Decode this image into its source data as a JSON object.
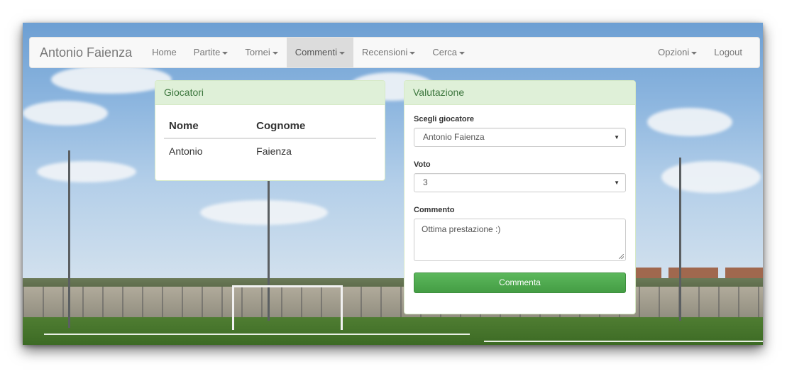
{
  "navbar": {
    "brand": "Antonio Faienza",
    "items": [
      {
        "label": "Home",
        "dropdown": false,
        "active": false
      },
      {
        "label": "Partite",
        "dropdown": true,
        "active": false
      },
      {
        "label": "Tornei",
        "dropdown": true,
        "active": false
      },
      {
        "label": "Commenti",
        "dropdown": true,
        "active": true
      },
      {
        "label": "Recensioni",
        "dropdown": true,
        "active": false
      },
      {
        "label": "Cerca",
        "dropdown": true,
        "active": false
      }
    ],
    "right_items": [
      {
        "label": "Opzioni",
        "dropdown": true
      },
      {
        "label": "Logout",
        "dropdown": false
      }
    ]
  },
  "giocatori": {
    "heading": "Giocatori",
    "columns": [
      "Nome",
      "Cognome"
    ],
    "rows": [
      [
        "Antonio",
        "Faienza"
      ]
    ]
  },
  "valutazione": {
    "heading": "Valutazione",
    "player_label": "Scegli giocatore",
    "player_value": "Antonio Faienza",
    "vote_label": "Voto",
    "vote_value": "3",
    "comment_label": "Commento",
    "comment_value": "Ottima prestazione :)",
    "submit_label": "Commenta"
  },
  "colors": {
    "panel_heading_bg": "#dff0d8",
    "panel_heading_text": "#3c763d",
    "button_green": "#5cb85c",
    "navbar_active_bg": "#dcdcdc"
  }
}
